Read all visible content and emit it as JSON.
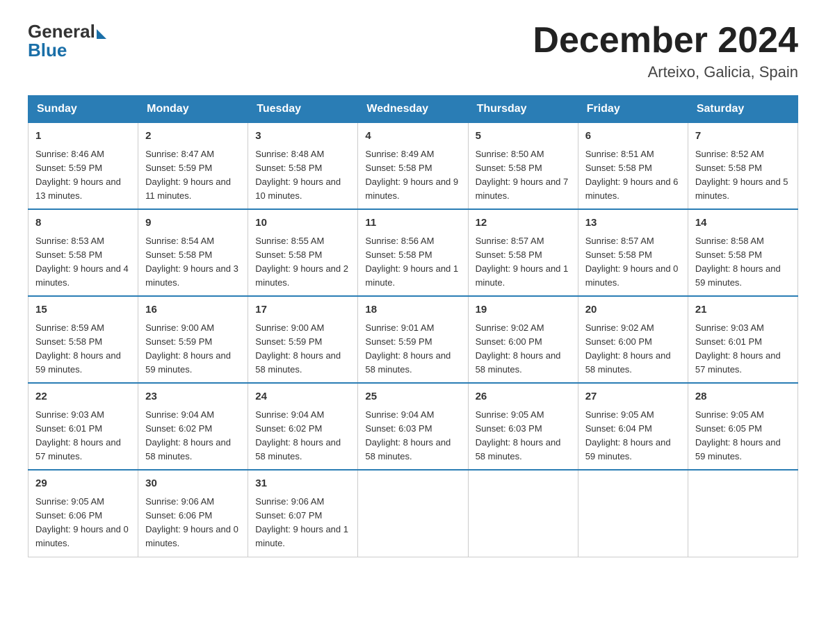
{
  "logo": {
    "general": "General",
    "blue": "Blue"
  },
  "title": "December 2024",
  "subtitle": "Arteixo, Galicia, Spain",
  "days_of_week": [
    "Sunday",
    "Monday",
    "Tuesday",
    "Wednesday",
    "Thursday",
    "Friday",
    "Saturday"
  ],
  "weeks": [
    [
      {
        "day": "1",
        "sunrise": "8:46 AM",
        "sunset": "5:59 PM",
        "daylight": "9 hours and 13 minutes."
      },
      {
        "day": "2",
        "sunrise": "8:47 AM",
        "sunset": "5:59 PM",
        "daylight": "9 hours and 11 minutes."
      },
      {
        "day": "3",
        "sunrise": "8:48 AM",
        "sunset": "5:58 PM",
        "daylight": "9 hours and 10 minutes."
      },
      {
        "day": "4",
        "sunrise": "8:49 AM",
        "sunset": "5:58 PM",
        "daylight": "9 hours and 9 minutes."
      },
      {
        "day": "5",
        "sunrise": "8:50 AM",
        "sunset": "5:58 PM",
        "daylight": "9 hours and 7 minutes."
      },
      {
        "day": "6",
        "sunrise": "8:51 AM",
        "sunset": "5:58 PM",
        "daylight": "9 hours and 6 minutes."
      },
      {
        "day": "7",
        "sunrise": "8:52 AM",
        "sunset": "5:58 PM",
        "daylight": "9 hours and 5 minutes."
      }
    ],
    [
      {
        "day": "8",
        "sunrise": "8:53 AM",
        "sunset": "5:58 PM",
        "daylight": "9 hours and 4 minutes."
      },
      {
        "day": "9",
        "sunrise": "8:54 AM",
        "sunset": "5:58 PM",
        "daylight": "9 hours and 3 minutes."
      },
      {
        "day": "10",
        "sunrise": "8:55 AM",
        "sunset": "5:58 PM",
        "daylight": "9 hours and 2 minutes."
      },
      {
        "day": "11",
        "sunrise": "8:56 AM",
        "sunset": "5:58 PM",
        "daylight": "9 hours and 1 minute."
      },
      {
        "day": "12",
        "sunrise": "8:57 AM",
        "sunset": "5:58 PM",
        "daylight": "9 hours and 1 minute."
      },
      {
        "day": "13",
        "sunrise": "8:57 AM",
        "sunset": "5:58 PM",
        "daylight": "9 hours and 0 minutes."
      },
      {
        "day": "14",
        "sunrise": "8:58 AM",
        "sunset": "5:58 PM",
        "daylight": "8 hours and 59 minutes."
      }
    ],
    [
      {
        "day": "15",
        "sunrise": "8:59 AM",
        "sunset": "5:58 PM",
        "daylight": "8 hours and 59 minutes."
      },
      {
        "day": "16",
        "sunrise": "9:00 AM",
        "sunset": "5:59 PM",
        "daylight": "8 hours and 59 minutes."
      },
      {
        "day": "17",
        "sunrise": "9:00 AM",
        "sunset": "5:59 PM",
        "daylight": "8 hours and 58 minutes."
      },
      {
        "day": "18",
        "sunrise": "9:01 AM",
        "sunset": "5:59 PM",
        "daylight": "8 hours and 58 minutes."
      },
      {
        "day": "19",
        "sunrise": "9:02 AM",
        "sunset": "6:00 PM",
        "daylight": "8 hours and 58 minutes."
      },
      {
        "day": "20",
        "sunrise": "9:02 AM",
        "sunset": "6:00 PM",
        "daylight": "8 hours and 58 minutes."
      },
      {
        "day": "21",
        "sunrise": "9:03 AM",
        "sunset": "6:01 PM",
        "daylight": "8 hours and 57 minutes."
      }
    ],
    [
      {
        "day": "22",
        "sunrise": "9:03 AM",
        "sunset": "6:01 PM",
        "daylight": "8 hours and 57 minutes."
      },
      {
        "day": "23",
        "sunrise": "9:04 AM",
        "sunset": "6:02 PM",
        "daylight": "8 hours and 58 minutes."
      },
      {
        "day": "24",
        "sunrise": "9:04 AM",
        "sunset": "6:02 PM",
        "daylight": "8 hours and 58 minutes."
      },
      {
        "day": "25",
        "sunrise": "9:04 AM",
        "sunset": "6:03 PM",
        "daylight": "8 hours and 58 minutes."
      },
      {
        "day": "26",
        "sunrise": "9:05 AM",
        "sunset": "6:03 PM",
        "daylight": "8 hours and 58 minutes."
      },
      {
        "day": "27",
        "sunrise": "9:05 AM",
        "sunset": "6:04 PM",
        "daylight": "8 hours and 59 minutes."
      },
      {
        "day": "28",
        "sunrise": "9:05 AM",
        "sunset": "6:05 PM",
        "daylight": "8 hours and 59 minutes."
      }
    ],
    [
      {
        "day": "29",
        "sunrise": "9:05 AM",
        "sunset": "6:06 PM",
        "daylight": "9 hours and 0 minutes."
      },
      {
        "day": "30",
        "sunrise": "9:06 AM",
        "sunset": "6:06 PM",
        "daylight": "9 hours and 0 minutes."
      },
      {
        "day": "31",
        "sunrise": "9:06 AM",
        "sunset": "6:07 PM",
        "daylight": "9 hours and 1 minute."
      },
      null,
      null,
      null,
      null
    ]
  ]
}
